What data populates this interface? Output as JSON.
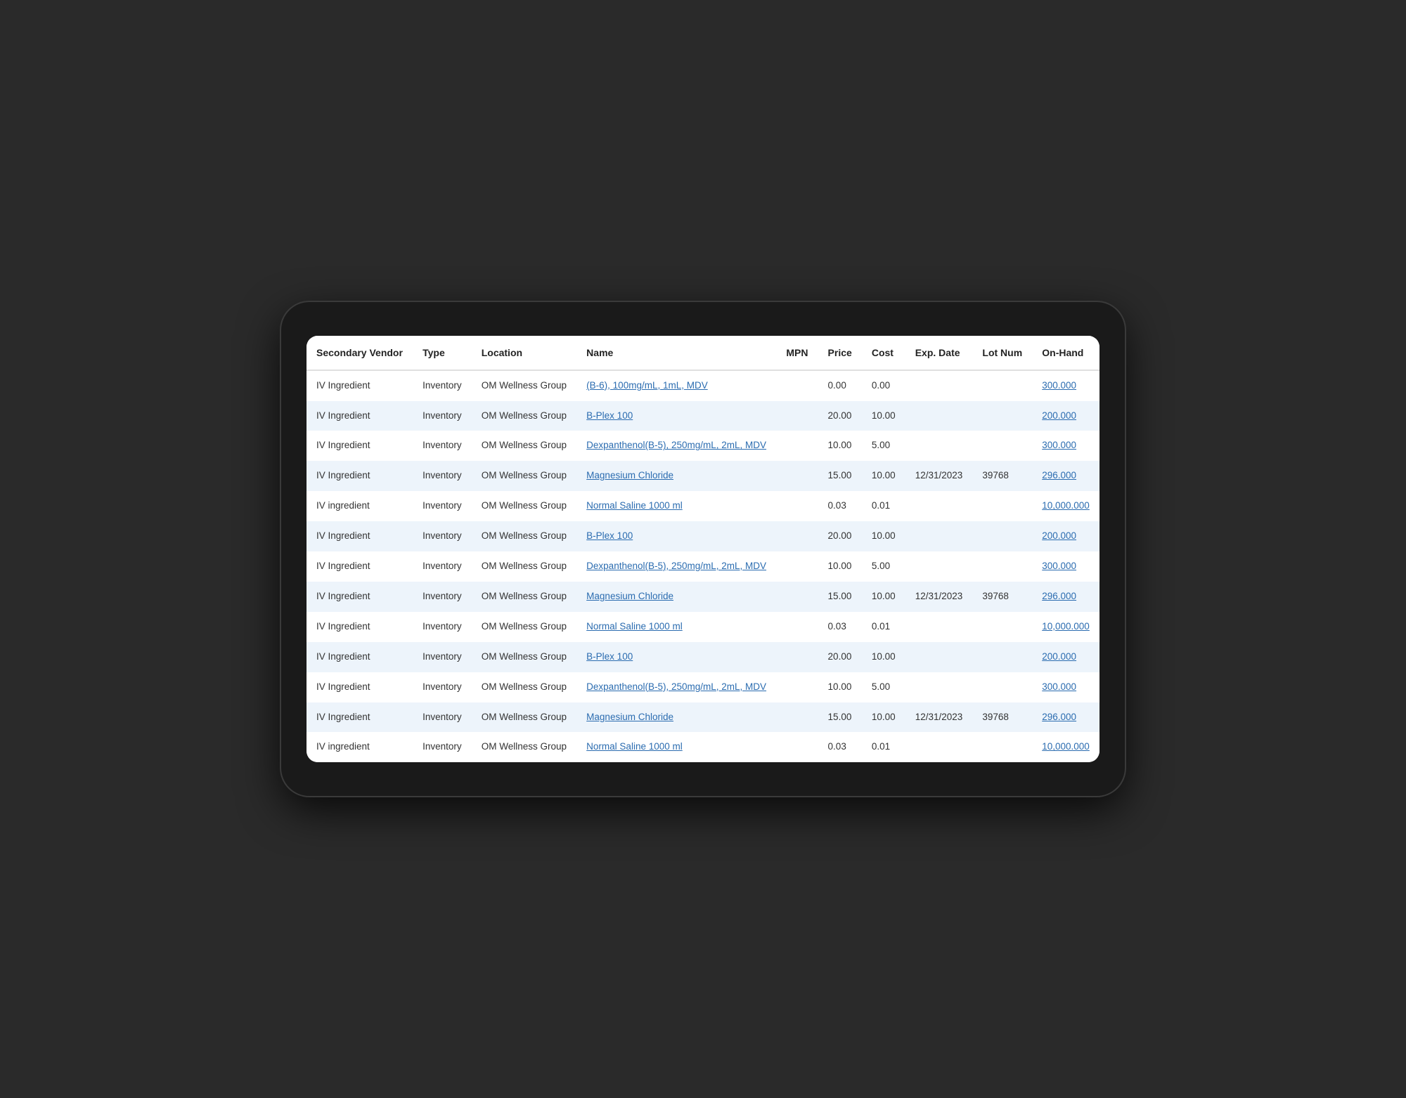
{
  "table": {
    "headers": [
      "Secondary Vendor",
      "Type",
      "Location",
      "Name",
      "MPN",
      "Price",
      "Cost",
      "Exp. Date",
      "Lot Num",
      "On-Hand"
    ],
    "rows": [
      {
        "secondary_vendor": "IV Ingredient",
        "type": "Inventory",
        "location": "OM Wellness Group",
        "name": "(B-6), 100mg/mL, 1mL, MDV",
        "mpn": "",
        "price": "0.00",
        "cost": "0.00",
        "exp_date": "",
        "lot_num": "",
        "on_hand": "300.000",
        "name_link": true,
        "on_hand_link": true
      },
      {
        "secondary_vendor": "IV Ingredient",
        "type": "Inventory",
        "location": "OM Wellness Group",
        "name": "B-Plex 100",
        "mpn": "",
        "price": "20.00",
        "cost": "10.00",
        "exp_date": "",
        "lot_num": "",
        "on_hand": "200.000",
        "name_link": true,
        "on_hand_link": true
      },
      {
        "secondary_vendor": "IV Ingredient",
        "type": "Inventory",
        "location": "OM Wellness Group",
        "name": "Dexpanthenol(B-5), 250mg/mL, 2mL, MDV",
        "mpn": "",
        "price": "10.00",
        "cost": "5.00",
        "exp_date": "",
        "lot_num": "",
        "on_hand": "300.000",
        "name_link": true,
        "on_hand_link": true
      },
      {
        "secondary_vendor": "IV Ingredient",
        "type": "Inventory",
        "location": "OM Wellness Group",
        "name": "Magnesium Chloride",
        "mpn": "",
        "price": "15.00",
        "cost": "10.00",
        "exp_date": "12/31/2023",
        "lot_num": "39768",
        "on_hand": "296.000",
        "name_link": true,
        "on_hand_link": true
      },
      {
        "secondary_vendor": "IV ingredient",
        "type": "Inventory",
        "location": "OM Wellness Group",
        "name": "Normal Saline 1000 ml",
        "mpn": "",
        "price": "0.03",
        "cost": "0.01",
        "exp_date": "",
        "lot_num": "",
        "on_hand": "10,000.000",
        "name_link": true,
        "on_hand_link": true
      },
      {
        "secondary_vendor": "IV Ingredient",
        "type": "Inventory",
        "location": "OM Wellness Group",
        "name": "B-Plex 100",
        "mpn": "",
        "price": "20.00",
        "cost": "10.00",
        "exp_date": "",
        "lot_num": "",
        "on_hand": "200.000",
        "name_link": true,
        "on_hand_link": true
      },
      {
        "secondary_vendor": "IV Ingredient",
        "type": "Inventory",
        "location": "OM Wellness Group",
        "name": "Dexpanthenol(B-5), 250mg/mL, 2mL, MDV",
        "mpn": "",
        "price": "10.00",
        "cost": "5.00",
        "exp_date": "",
        "lot_num": "",
        "on_hand": "300.000",
        "name_link": true,
        "on_hand_link": true
      },
      {
        "secondary_vendor": "IV Ingredient",
        "type": "Inventory",
        "location": "OM Wellness Group",
        "name": "Magnesium Chloride",
        "mpn": "",
        "price": "15.00",
        "cost": "10.00",
        "exp_date": "12/31/2023",
        "lot_num": "39768",
        "on_hand": "296.000",
        "name_link": true,
        "on_hand_link": true
      },
      {
        "secondary_vendor": "IV Ingredient",
        "type": "Inventory",
        "location": "OM Wellness Group",
        "name": "Normal Saline 1000 ml",
        "mpn": "",
        "price": "0.03",
        "cost": "0.01",
        "exp_date": "",
        "lot_num": "",
        "on_hand": "10,000.000",
        "name_link": true,
        "on_hand_link": true
      },
      {
        "secondary_vendor": "IV Ingredient",
        "type": "Inventory",
        "location": "OM Wellness Group",
        "name": "B-Plex 100",
        "mpn": "",
        "price": "20.00",
        "cost": "10.00",
        "exp_date": "",
        "lot_num": "",
        "on_hand": "200.000",
        "name_link": true,
        "on_hand_link": true
      },
      {
        "secondary_vendor": "IV Ingredient",
        "type": "Inventory",
        "location": "OM Wellness Group",
        "name": "Dexpanthenol(B-5), 250mg/mL, 2mL, MDV",
        "mpn": "",
        "price": "10.00",
        "cost": "5.00",
        "exp_date": "",
        "lot_num": "",
        "on_hand": "300.000",
        "name_link": true,
        "on_hand_link": true
      },
      {
        "secondary_vendor": "IV Ingredient",
        "type": "Inventory",
        "location": "OM Wellness Group",
        "name": "Magnesium Chloride",
        "mpn": "",
        "price": "15.00",
        "cost": "10.00",
        "exp_date": "12/31/2023",
        "lot_num": "39768",
        "on_hand": "296.000",
        "name_link": true,
        "on_hand_link": true
      },
      {
        "secondary_vendor": "IV ingredient",
        "type": "Inventory",
        "location": "OM Wellness Group",
        "name": "Normal Saline 1000 ml",
        "mpn": "",
        "price": "0.03",
        "cost": "0.01",
        "exp_date": "",
        "lot_num": "",
        "on_hand": "10,000.000",
        "name_link": true,
        "on_hand_link": true
      }
    ]
  }
}
